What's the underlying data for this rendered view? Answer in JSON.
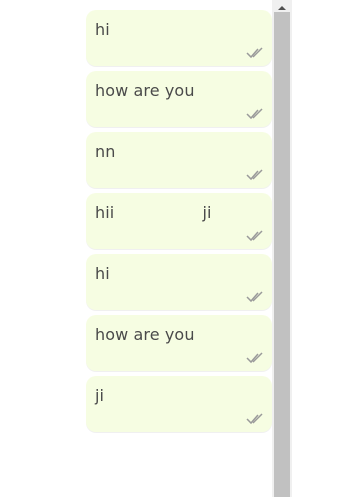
{
  "chat": {
    "messages": [
      {
        "text": "hi",
        "status": "read"
      },
      {
        "text": "how are you",
        "status": "read"
      },
      {
        "text": "nn",
        "status": "read"
      },
      {
        "text": "hii                 ji",
        "status": "read"
      },
      {
        "text": "hi",
        "status": "read"
      },
      {
        "text": "how are you",
        "status": "read"
      },
      {
        "text": "ji",
        "status": "read"
      }
    ],
    "colors": {
      "bubble": "#f6fde2",
      "text": "#4a4a4a",
      "ticks": "#9a9a9a"
    },
    "icons": {
      "status": "double-check-icon",
      "scroll_up": "triangle-up-icon"
    }
  },
  "scrollbar": {
    "thumb_fraction": 1.0
  }
}
